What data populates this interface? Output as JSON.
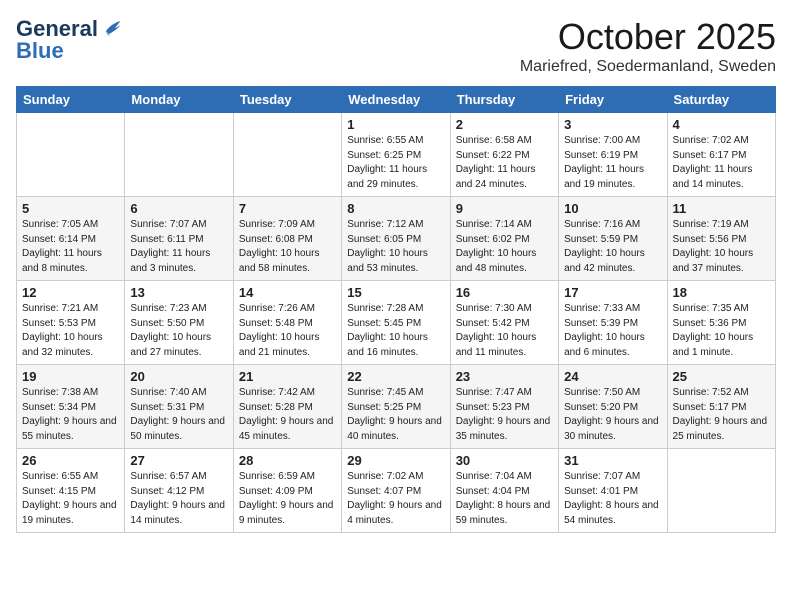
{
  "header": {
    "logo_general": "General",
    "logo_blue": "Blue",
    "month": "October 2025",
    "location": "Mariefred, Soedermanland, Sweden"
  },
  "weekdays": [
    "Sunday",
    "Monday",
    "Tuesday",
    "Wednesday",
    "Thursday",
    "Friday",
    "Saturday"
  ],
  "weeks": [
    [
      {
        "day": "",
        "info": ""
      },
      {
        "day": "",
        "info": ""
      },
      {
        "day": "",
        "info": ""
      },
      {
        "day": "1",
        "info": "Sunrise: 6:55 AM\nSunset: 6:25 PM\nDaylight: 11 hours and 29 minutes."
      },
      {
        "day": "2",
        "info": "Sunrise: 6:58 AM\nSunset: 6:22 PM\nDaylight: 11 hours and 24 minutes."
      },
      {
        "day": "3",
        "info": "Sunrise: 7:00 AM\nSunset: 6:19 PM\nDaylight: 11 hours and 19 minutes."
      },
      {
        "day": "4",
        "info": "Sunrise: 7:02 AM\nSunset: 6:17 PM\nDaylight: 11 hours and 14 minutes."
      }
    ],
    [
      {
        "day": "5",
        "info": "Sunrise: 7:05 AM\nSunset: 6:14 PM\nDaylight: 11 hours and 8 minutes."
      },
      {
        "day": "6",
        "info": "Sunrise: 7:07 AM\nSunset: 6:11 PM\nDaylight: 11 hours and 3 minutes."
      },
      {
        "day": "7",
        "info": "Sunrise: 7:09 AM\nSunset: 6:08 PM\nDaylight: 10 hours and 58 minutes."
      },
      {
        "day": "8",
        "info": "Sunrise: 7:12 AM\nSunset: 6:05 PM\nDaylight: 10 hours and 53 minutes."
      },
      {
        "day": "9",
        "info": "Sunrise: 7:14 AM\nSunset: 6:02 PM\nDaylight: 10 hours and 48 minutes."
      },
      {
        "day": "10",
        "info": "Sunrise: 7:16 AM\nSunset: 5:59 PM\nDaylight: 10 hours and 42 minutes."
      },
      {
        "day": "11",
        "info": "Sunrise: 7:19 AM\nSunset: 5:56 PM\nDaylight: 10 hours and 37 minutes."
      }
    ],
    [
      {
        "day": "12",
        "info": "Sunrise: 7:21 AM\nSunset: 5:53 PM\nDaylight: 10 hours and 32 minutes."
      },
      {
        "day": "13",
        "info": "Sunrise: 7:23 AM\nSunset: 5:50 PM\nDaylight: 10 hours and 27 minutes."
      },
      {
        "day": "14",
        "info": "Sunrise: 7:26 AM\nSunset: 5:48 PM\nDaylight: 10 hours and 21 minutes."
      },
      {
        "day": "15",
        "info": "Sunrise: 7:28 AM\nSunset: 5:45 PM\nDaylight: 10 hours and 16 minutes."
      },
      {
        "day": "16",
        "info": "Sunrise: 7:30 AM\nSunset: 5:42 PM\nDaylight: 10 hours and 11 minutes."
      },
      {
        "day": "17",
        "info": "Sunrise: 7:33 AM\nSunset: 5:39 PM\nDaylight: 10 hours and 6 minutes."
      },
      {
        "day": "18",
        "info": "Sunrise: 7:35 AM\nSunset: 5:36 PM\nDaylight: 10 hours and 1 minute."
      }
    ],
    [
      {
        "day": "19",
        "info": "Sunrise: 7:38 AM\nSunset: 5:34 PM\nDaylight: 9 hours and 55 minutes."
      },
      {
        "day": "20",
        "info": "Sunrise: 7:40 AM\nSunset: 5:31 PM\nDaylight: 9 hours and 50 minutes."
      },
      {
        "day": "21",
        "info": "Sunrise: 7:42 AM\nSunset: 5:28 PM\nDaylight: 9 hours and 45 minutes."
      },
      {
        "day": "22",
        "info": "Sunrise: 7:45 AM\nSunset: 5:25 PM\nDaylight: 9 hours and 40 minutes."
      },
      {
        "day": "23",
        "info": "Sunrise: 7:47 AM\nSunset: 5:23 PM\nDaylight: 9 hours and 35 minutes."
      },
      {
        "day": "24",
        "info": "Sunrise: 7:50 AM\nSunset: 5:20 PM\nDaylight: 9 hours and 30 minutes."
      },
      {
        "day": "25",
        "info": "Sunrise: 7:52 AM\nSunset: 5:17 PM\nDaylight: 9 hours and 25 minutes."
      }
    ],
    [
      {
        "day": "26",
        "info": "Sunrise: 6:55 AM\nSunset: 4:15 PM\nDaylight: 9 hours and 19 minutes."
      },
      {
        "day": "27",
        "info": "Sunrise: 6:57 AM\nSunset: 4:12 PM\nDaylight: 9 hours and 14 minutes."
      },
      {
        "day": "28",
        "info": "Sunrise: 6:59 AM\nSunset: 4:09 PM\nDaylight: 9 hours and 9 minutes."
      },
      {
        "day": "29",
        "info": "Sunrise: 7:02 AM\nSunset: 4:07 PM\nDaylight: 9 hours and 4 minutes."
      },
      {
        "day": "30",
        "info": "Sunrise: 7:04 AM\nSunset: 4:04 PM\nDaylight: 8 hours and 59 minutes."
      },
      {
        "day": "31",
        "info": "Sunrise: 7:07 AM\nSunset: 4:01 PM\nDaylight: 8 hours and 54 minutes."
      },
      {
        "day": "",
        "info": ""
      }
    ]
  ]
}
